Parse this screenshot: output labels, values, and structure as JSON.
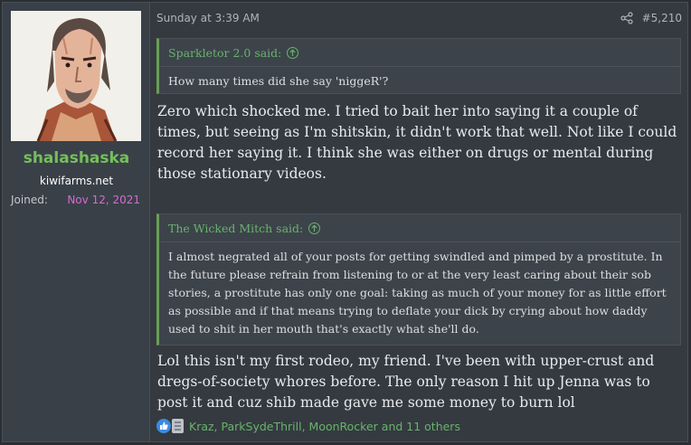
{
  "user": {
    "username": "shalashaska",
    "user_title": "kiwifarms.net",
    "joined_label": "Joined:",
    "joined_value": "Nov 12, 2021"
  },
  "post": {
    "date": "Sunday at 3:39 AM",
    "number": "#5,210",
    "quote1": {
      "author": "Sparkletor 2.0 said:",
      "text": "How many times did she say 'niggeR'?"
    },
    "message1": "Zero which shocked me. I tried to bait her into saying it a couple of times, but seeing as I'm shitskin, it didn't work that well. Not like I could record her saying it. I think she was either on drugs or mental during those stationary videos.",
    "quote2": {
      "author": "The Wicked Mitch said:",
      "text": "I almost negrated all of your posts for getting swindled and pimped by a prostitute. In the future please refrain from listening to or at the very least caring about their sob stories, a prostitute has only one goal: taking as much of your money for as little effort as possible and if that means trying to deflate your dick by crying about how daddy used to shit in her mouth that's exactly what she'll do."
    },
    "message2": "Lol this isn't my first rodeo, my friend. I've been with upper-crust and dregs-of-society whores before. The only reason I hit up Jenna was to post it and cuz shib made gave me some money to burn lol",
    "reactions_text": "Kraz, ParkSydeThrill, MoonRocker and 11 others"
  },
  "icons": {
    "share": "share-icon",
    "quote_arrow": "arrow-up-circle-icon",
    "like": "like-icon",
    "reaction_other": "reaction-icon"
  },
  "colors": {
    "username": "#74c05a",
    "joined_value": "#d36cd0",
    "quote_author": "#67b36b",
    "background": "#353a40"
  }
}
